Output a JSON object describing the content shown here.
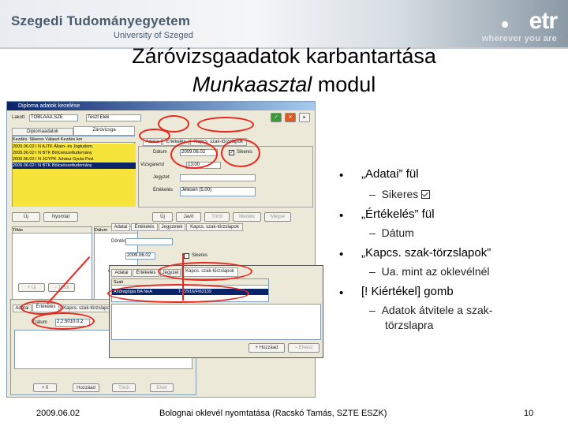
{
  "header": {
    "university_name": "Szegedi Tudományegyetem",
    "university_sub": "University of Szeged",
    "logo_text": "etr",
    "logo_sub": "wherever you are"
  },
  "title": {
    "line1": "Záróvizsgaadatok karbantartása",
    "line2_italic": "Munkaasztal",
    "line2_rest": " modul"
  },
  "screenshot": {
    "main_window_title": "Diploma adatok kezelése",
    "field_user_label": "Lakott",
    "field_user_value": "TOBLAAA.SZE",
    "field_search_value": "Teszt Elek",
    "tab_diploma": "Diplomaadatok",
    "tab_zarovizsga": "Záróvizsga",
    "tab_ertekeles": "Értékelés",
    "tab_kapcs": "Kapcs. szak-törzslapok",
    "tab_adatai": "Adatai",
    "grid_header": [
      "Kezdés",
      "Sikeres",
      "Választ",
      "Kezdés kor"
    ],
    "grid_rows": [
      "2009.06.02   I   N   AJTK Állam- és Jogtudom.",
      "2009.06.02   I   N   BTK Bölcsészettudomány",
      "2009.06.02   I   N   JGYPK Juhász Gyula Ped.",
      "2009.06.02   I   N   BTK Bölcsészettudomány"
    ],
    "label_datum": "Dátum",
    "datum_value": "2009.06.02",
    "label_sikeres": "Sikeres",
    "label_vizsgarend": "Vizsgarend",
    "vizsgarend_value": "13:00",
    "label_jegyzetek": "Jegyzet",
    "label_ertekeles": "Értékelés",
    "ertekeles_value": "Jelesen (5,00)",
    "btn_uj": "Új",
    "btn_nyomtat": "Nyomtat",
    "btn_ujra": "Új",
    "btn_javit": "Javít",
    "btn_torol": "Töröl",
    "btn_mentes": "Mentés",
    "btn_megse": "Mégse",
    "label_tiltas": "Tiltás",
    "label_tipus": "Típus",
    "label_dontes": "Döntés",
    "tab_jegyzet": "Jegyzet",
    "tab_jegyzetek": "Jegyzetek",
    "kapcs_row1_label": "Szak",
    "kapcs_row2": "Andragógia BA NeA",
    "kapcs_row2_code": "T-22916/FI63139",
    "kapcs_header": "Kapcs. szak-törzslapok",
    "dialog_tab1": "Adatai",
    "dialog_tab2": "Értékelés",
    "dialog_tab3": "Kapcs. szak-törzslapok",
    "dialog_datum_label": "Dátum",
    "dialog_datum_value": "2.2.5010.0.2",
    "dialog_hozzaad": "+ Hozzáad",
    "dialog_elvesz": "− Elvesz",
    "dialog_btn_add": "+ 0",
    "dialog_btn_hozzaad2": "Hozzáad",
    "dialog_btn_torol": "Töröl",
    "dialog_btn_elvet": "Elvet"
  },
  "bullets": {
    "item1": "„Adatai” fül",
    "item1_sub": "Sikeres",
    "item2": "„Értékelés” fül",
    "item2_sub": "Dátum",
    "item3": "„Kapcs. szak-törzslapok”",
    "item3_sub": "Ua. mint az oklevélnél",
    "item4": "[! Kiértékel] gomb",
    "item4_sub_line1": "Adatok átvitele a szak-",
    "item4_sub_line2": "törzslapra",
    "bullet_char": "•",
    "dash_char": "–"
  },
  "footer": {
    "date": "2009.06.02",
    "center": "Bolognai oklevél nyomtatása (Racskó Tamás, SZTE ESZK)",
    "page": "10"
  },
  "colors": {
    "accent_red": "#e8281e",
    "grid_yellow": "#f7e43b",
    "grid_selected": "#0a246a",
    "window_bg": "#ece9d8"
  }
}
